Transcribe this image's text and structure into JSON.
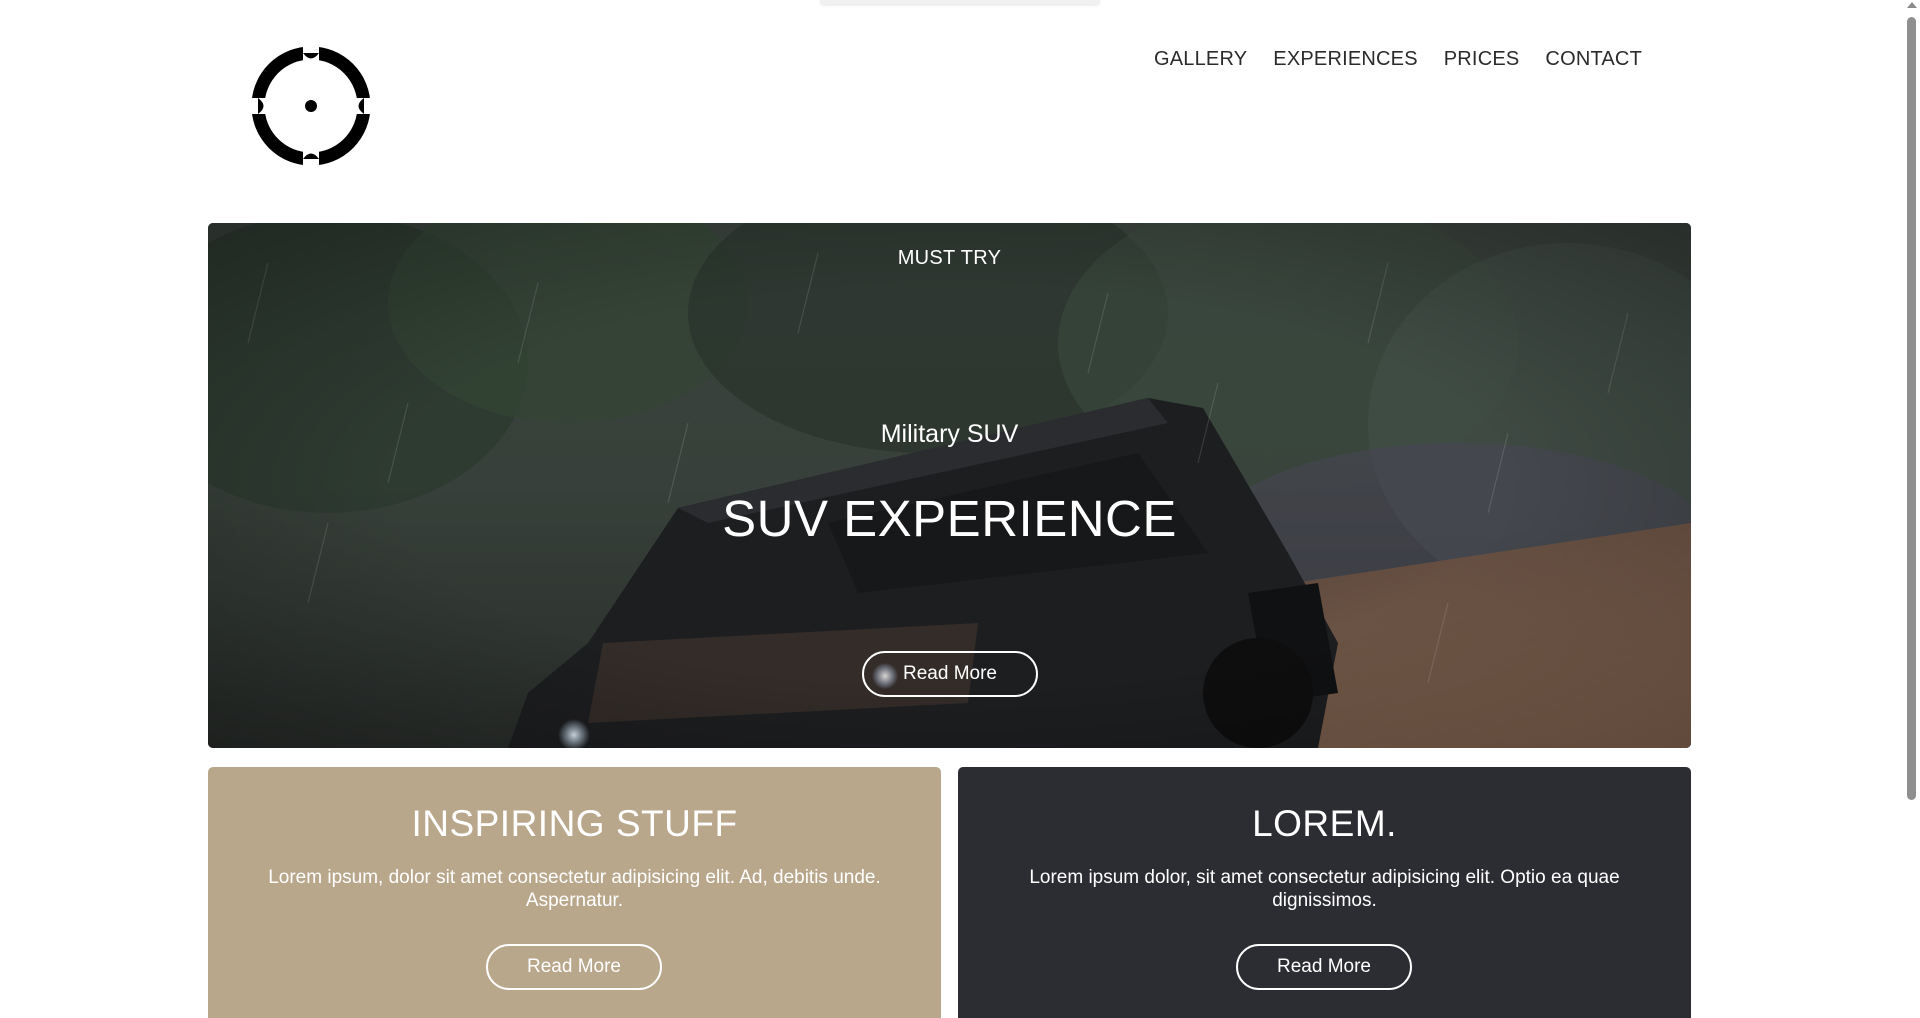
{
  "nav": {
    "items": [
      "GALLERY",
      "EXPERIENCES",
      "PRICES",
      "CONTACT"
    ]
  },
  "hero": {
    "eyebrow": "MUST TRY",
    "subtitle": "Military SUV",
    "title": "SUV EXPERIENCE",
    "button_label": "Read More"
  },
  "cards": [
    {
      "title": "INSPIRING STUFF",
      "text": "Lorem ipsum, dolor sit amet consectetur adipisicing elit. Ad, debitis unde. Aspernatur.",
      "button_label": "Read More",
      "background": "#b9a78c"
    },
    {
      "title": "LOREM.",
      "text": "Lorem ipsum dolor, sit amet consectetur adipisicing elit. Optio ea quae dignissimos.",
      "button_label": "Read More",
      "background": "#2c2c33"
    }
  ],
  "icons": {
    "logo": "crosshair-logo-icon"
  }
}
